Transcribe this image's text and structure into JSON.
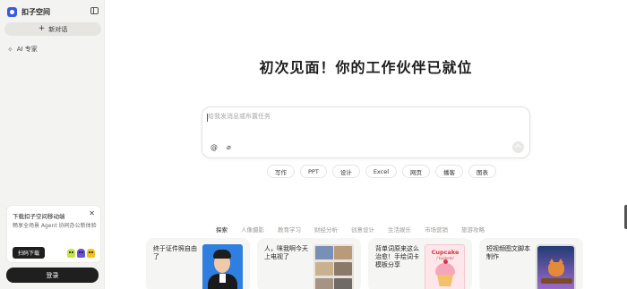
{
  "app": {
    "name": "扣子空间"
  },
  "sidebar": {
    "new_chat": "新对话",
    "items": [
      {
        "label": "AI 专家",
        "icon": "sparkle-icon"
      }
    ],
    "promo": {
      "title": "下载扣子空间移动端",
      "description": "畅享全场景 Agent 协同办公新体验",
      "button": "扫码下载"
    },
    "login": "登录"
  },
  "main": {
    "headline": "初次见面！你的工作伙伴已就位",
    "composer": {
      "placeholder": "给我发消息或布置任务"
    },
    "quick_actions": [
      "写作",
      "PPT",
      "设计",
      "Excel",
      "网页",
      "播客",
      "图表"
    ],
    "category_tabs": [
      "探索",
      "人像摄影",
      "教育学习",
      "财经分析",
      "创意设计",
      "生活娱乐",
      "市场营销",
      "旅游攻略"
    ],
    "active_tab": "探索",
    "cards": [
      {
        "text": "终于证件照自由了"
      },
      {
        "text": "人，咪我啊今天上电视了"
      },
      {
        "text": "背单词原来这么治愈！手绘词卡模板分享",
        "thumb_title": "Cupcake",
        "thumb_subtitle": "/ˈkʌpkeɪk/"
      },
      {
        "text": "短视频图文脚本制作"
      }
    ]
  },
  "colors": {
    "primary_dark": "#1f1f1f",
    "sidebar_bg": "#f3f3f1",
    "brand_blue": "#3b5bdb"
  }
}
